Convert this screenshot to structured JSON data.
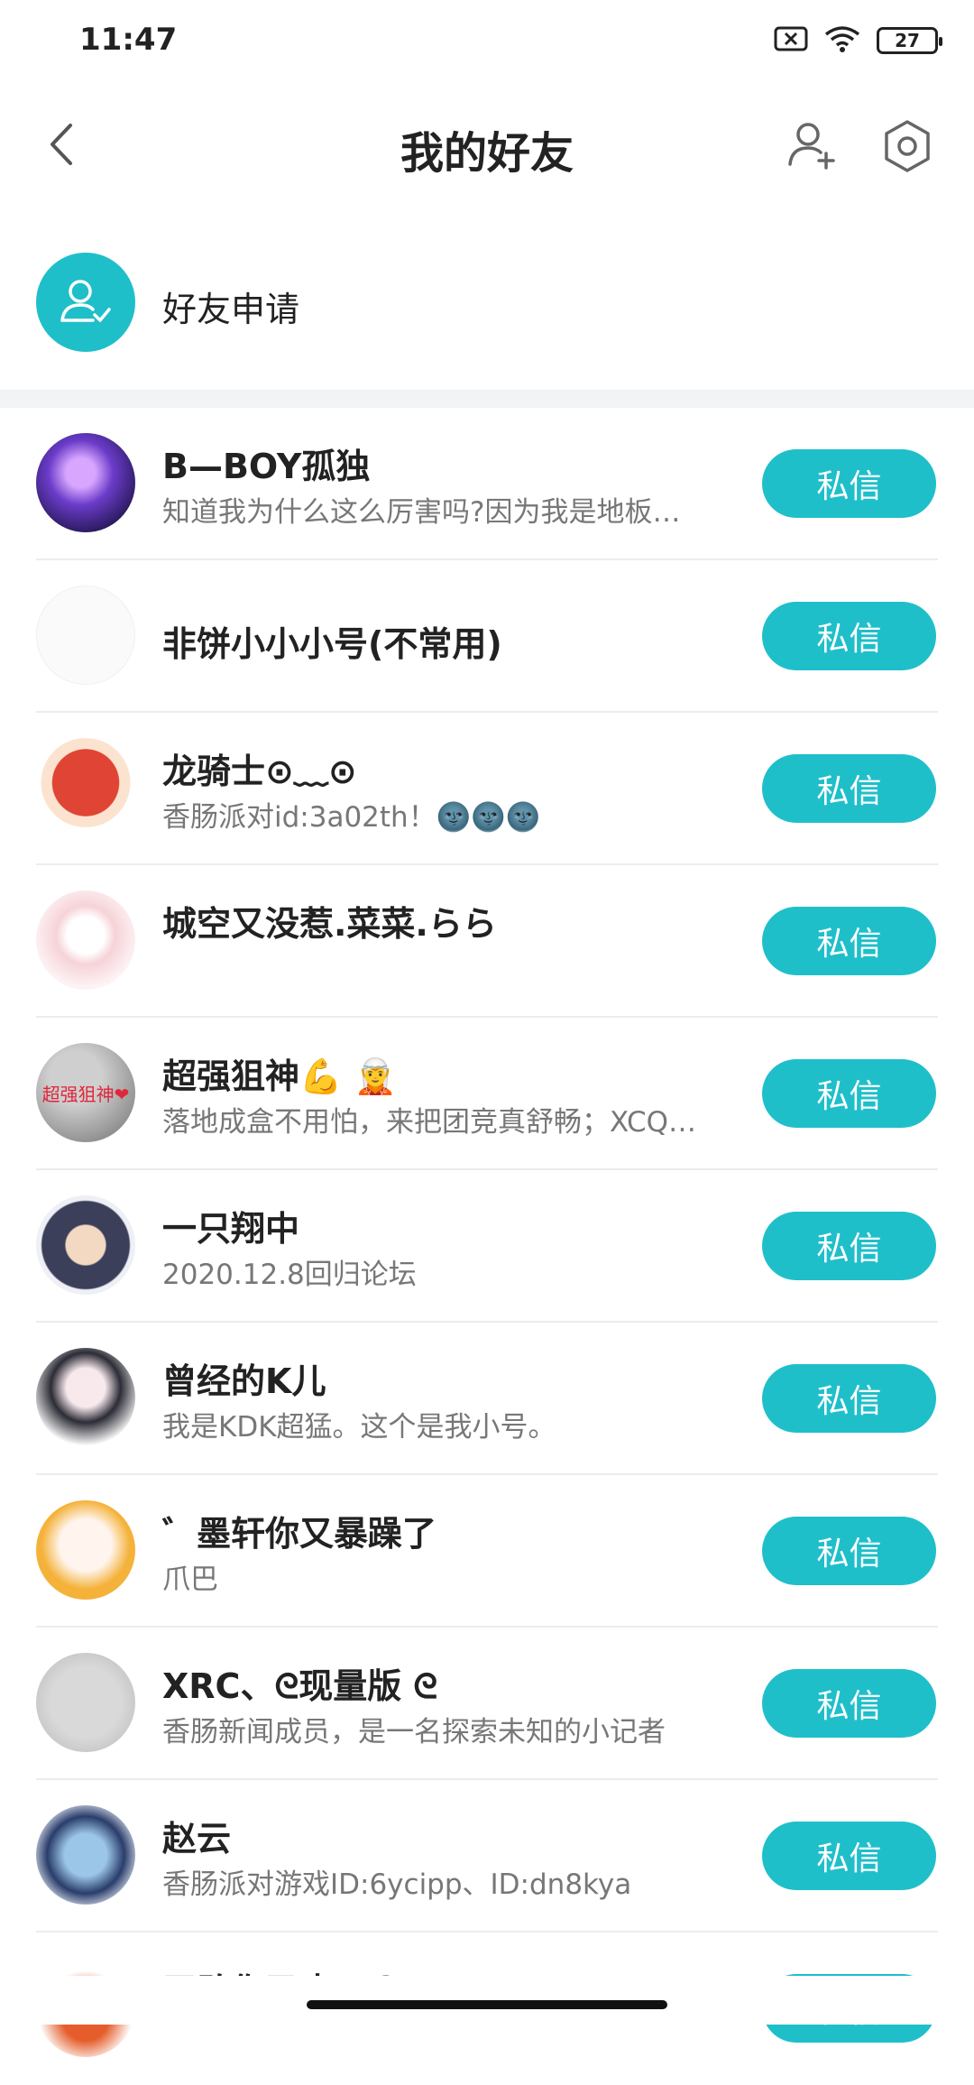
{
  "status": {
    "time": "11:47",
    "battery": "27"
  },
  "header": {
    "title": "我的好友"
  },
  "request": {
    "label": "好友申请"
  },
  "dm_label": "私信",
  "friends": [
    {
      "name": "B—BOY孤独",
      "bio": "知道我为什么这么厉害吗?因为我是地板…"
    },
    {
      "name": "非饼小小小号(不常用)",
      "bio": ""
    },
    {
      "name": "龙骑士⊙﹏⊙",
      "bio": "香肠派对id:3a02th！🌚🌚🌚"
    },
    {
      "name": "城空又没惹.菜菜.らら",
      "bio": ""
    },
    {
      "name": "超强狙神💪 🧝",
      "bio": "落地成盒不用怕，来把团竞真舒畅；XCQ…",
      "avatar_text": "超强狙神❤"
    },
    {
      "name": "一只翔中",
      "bio": "2020.12.8回归论坛"
    },
    {
      "name": "曾经的K儿",
      "bio": "我是KDK超猛。这个是我小号。"
    },
    {
      "name": "゛墨轩你又暴躁了",
      "bio": "爪巴"
    },
    {
      "name": "XRC、ᘓ现量版 ᘓ",
      "bio": "香肠新闻成员，是一名探索未知的小记者"
    },
    {
      "name": "赵云",
      "bio": "香肠派对游戏ID:6ycipp、ID:dn8kya"
    },
    {
      "name": "王敢你又皮了😏",
      "bio": ""
    }
  ]
}
